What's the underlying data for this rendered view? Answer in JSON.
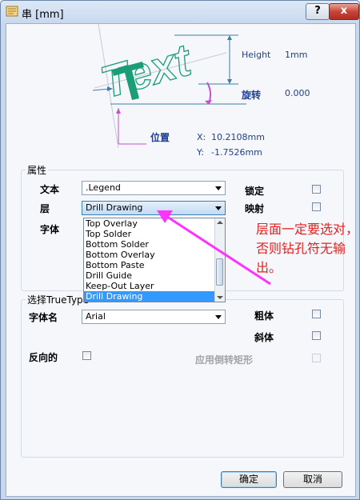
{
  "titlebar": {
    "title": "串 [mm]",
    "help_icon": "?",
    "close_icon": "x"
  },
  "preview": {
    "sample_text": "Text",
    "height_label": "Height",
    "height_value": "1mm",
    "rotation_label": "旋转",
    "rotation_value": "0.000",
    "position_label": "位置",
    "x_label": "X:",
    "x_value": "10.2108mm",
    "y_label": "Y:",
    "y_value": "-1.7526mm"
  },
  "properties": {
    "title": "属性",
    "text_label": "文本",
    "text_value": ".Legend",
    "layer_label": "层",
    "layer_value": "Drill Drawing",
    "font_label": "字体",
    "lock_label": "锁定",
    "mirror_label": "映射",
    "layer_options": [
      "Top Overlay",
      "Top Solder",
      "Bottom Solder",
      "Bottom Overlay",
      "Bottom Paste",
      "Drill Guide",
      "Keep-Out Layer",
      "Drill Drawing"
    ]
  },
  "truetype": {
    "title": "选择TrueType",
    "font_name_label": "字体名",
    "font_name_value": "Arial",
    "bold_label": "粗体",
    "italic_label": "斜体",
    "inverted_label": "反向的",
    "inverted_rect_label": "应用倒转矩形"
  },
  "annotation": "层面一定要选对，否则钻孔符无输出。",
  "buttons": {
    "ok": "确定",
    "cancel": "取消"
  },
  "colors": {
    "text_accent": "#1a9e78",
    "annotation": "#e82020",
    "arrow": "#ff33ff",
    "selection": "#3399ff"
  }
}
